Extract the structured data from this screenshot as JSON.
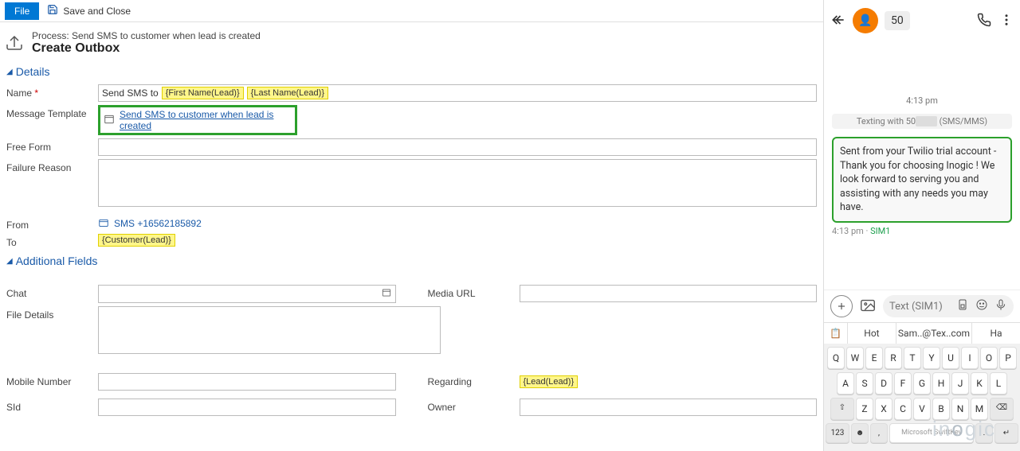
{
  "toolbar": {
    "file_label": "File",
    "save_close_label": "Save and Close"
  },
  "header": {
    "process_label": "Process: Send SMS to customer when lead is created",
    "page_title": "Create Outbox"
  },
  "sections": {
    "details": "Details",
    "additional": "Additional Fields"
  },
  "fields": {
    "name": {
      "label": "Name",
      "required": true,
      "prefix_text": "Send SMS to",
      "chip1": "{First Name(Lead)}",
      "chip2": "{Last Name(Lead)}"
    },
    "template": {
      "label": "Message Template",
      "value": "Send SMS to customer when lead is created"
    },
    "freeform": {
      "label": "Free Form"
    },
    "failure": {
      "label": "Failure Reason"
    },
    "from": {
      "label": "From",
      "value": "SMS +16562185892"
    },
    "to": {
      "label": "To",
      "chip": "{Customer(Lead)}"
    },
    "chat": {
      "label": "Chat"
    },
    "media_url": {
      "label": "Media URL"
    },
    "file_details": {
      "label": "File Details"
    },
    "mobile": {
      "label": "Mobile Number"
    },
    "regarding": {
      "label": "Regarding",
      "chip": "{Lead(Lead)}"
    },
    "sid": {
      "label": "SId"
    },
    "owner": {
      "label": "Owner"
    }
  },
  "phone": {
    "contact_number": "50",
    "time_center": "4:13 pm",
    "texting_with_prefix": "Texting with 50",
    "texting_with_suffix": " (SMS/MMS)",
    "message_text": "Sent from your Twilio trial account - Thank you for choosing Inogic ! We look forward to serving you and assisting with any needs you may have.",
    "msg_time": "4:13 pm",
    "msg_sim": "SIM1",
    "compose_placeholder": "Text (SIM1)",
    "suggestions": {
      "s1": "Hot",
      "s2": "Sam..@Tex..com",
      "s3": "Ha"
    },
    "keyboard": {
      "row1": [
        "Q",
        "W",
        "E",
        "R",
        "T",
        "Y",
        "U",
        "I",
        "O",
        "P"
      ],
      "row2": [
        "A",
        "S",
        "D",
        "F",
        "G",
        "H",
        "J",
        "K",
        "L"
      ],
      "row3": [
        "Z",
        "X",
        "C",
        "V",
        "B",
        "N",
        "M"
      ],
      "num_label": "123",
      "space_label": "Microsoft SwiftKey"
    }
  },
  "watermark": "inogic"
}
